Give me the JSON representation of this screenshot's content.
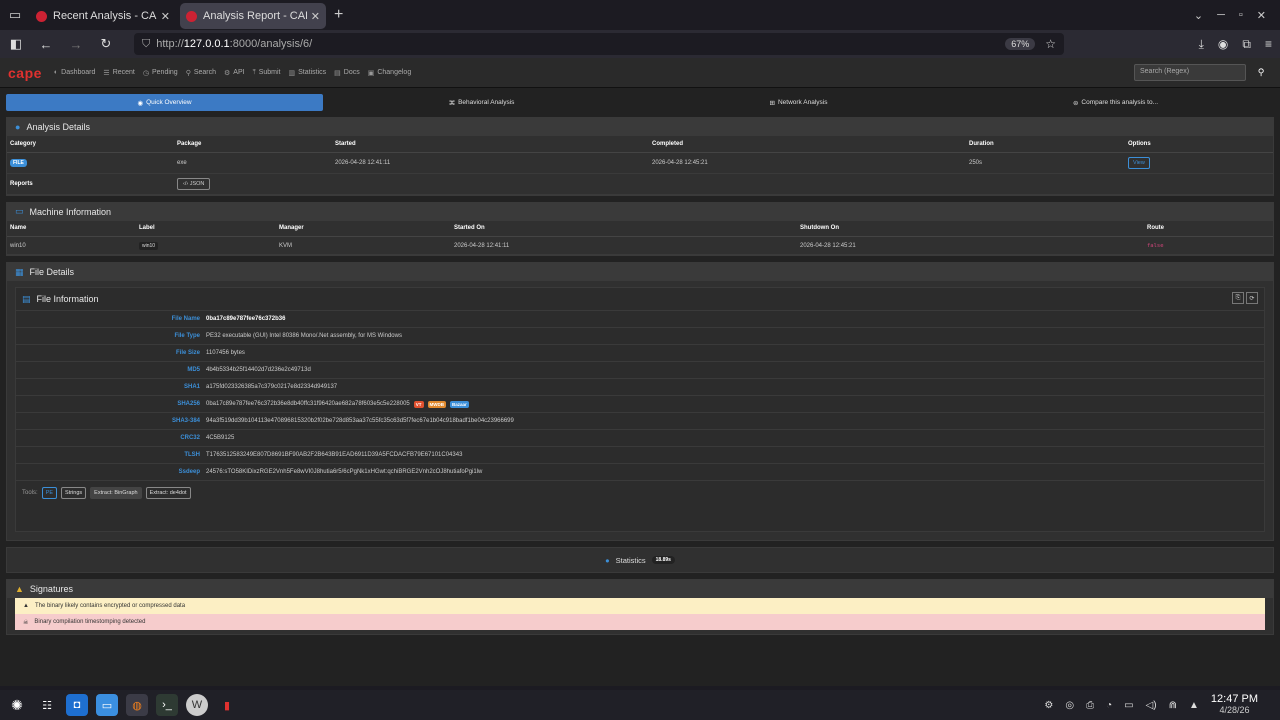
{
  "browser": {
    "tabs": [
      {
        "title": "Recent Analysis - CAPE Sandbox",
        "active": false
      },
      {
        "title": "Analysis Report - CAPE Sandbox",
        "active": true
      }
    ],
    "url_prefix": "http://",
    "url_host": "127.0.0.1",
    "url_path": ":8000/analysis/6/",
    "zoom": "67%"
  },
  "cape_nav": {
    "logo": "cape",
    "links": [
      "Dashboard",
      "Recent",
      "Pending",
      "Search",
      "API",
      "Submit",
      "Statistics",
      "Docs",
      "Changelog"
    ],
    "search_placeholder": "Search (Regex)"
  },
  "tabs": [
    "Quick Overview",
    "Behavioral Analysis",
    "Network Analysis",
    "Compare this analysis to..."
  ],
  "analysis_details": {
    "title": "Analysis Details",
    "headers": [
      "Category",
      "Package",
      "Started",
      "Completed",
      "Duration",
      "Options"
    ],
    "row": {
      "category": "FILE",
      "package": "exe",
      "started": "2026-04-28 12:41:11",
      "completed": "2026-04-28 12:45:21",
      "duration": "250s",
      "options": "View"
    },
    "reports_label": "Reports",
    "json_button": "JSON"
  },
  "machine_info": {
    "title": "Machine Information",
    "headers": [
      "Name",
      "Label",
      "Manager",
      "Started On",
      "Shutdown On",
      "Route"
    ],
    "row": {
      "name": "win10",
      "label": "win10",
      "manager": "KVM",
      "started_on": "2026-04-28 12:41:11",
      "shutdown_on": "2026-04-28 12:45:21",
      "route": "false"
    }
  },
  "file_details": {
    "title": "File Details",
    "sub_title": "File Information",
    "fields": [
      {
        "key": "File Name",
        "value": "0ba17c89e787fee76c372b36"
      },
      {
        "key": "File Type",
        "value": "PE32 executable (GUI) Intel 80386 Mono/.Net assembly, for MS Windows"
      },
      {
        "key": "File Size",
        "value": "1107456 bytes"
      },
      {
        "key": "MD5",
        "value": "4b4b5334b25f14402d7d236e2c49713d"
      },
      {
        "key": "SHA1",
        "value": "a175fd023326385a7c379c0217e8d2334d949137"
      },
      {
        "key": "SHA256",
        "value": "0ba17c89e787fee76c372b36e8db40ffc31f96420ae682a78f603e5c5e228005"
      },
      {
        "key": "SHA3-384",
        "value": "94a3f519dd39b104113e470896815320b2f02be728d853aa37c55fc35c63d5f7fec67e1b04c918badf1be04c23966699"
      },
      {
        "key": "CRC32",
        "value": "4C5B9125"
      },
      {
        "key": "TLSH",
        "value": "T1763512583249E807D8691BF90AB2F2B643B91EAD6911D39A5FCDACFB79E67101C04343"
      },
      {
        "key": "Ssdeep",
        "value": "24576:sTO58KIDixzRGE2Vnh5Fe8wVI0J8hutia6r5/6cPgNk1xHGwt:qchiBRGE2Vnh2cOJ8hutiafoPgi1lw"
      }
    ],
    "sha256_badges": [
      {
        "label": "VT",
        "color": "#e0512f"
      },
      {
        "label": "MWDB",
        "color": "#e08a2f"
      },
      {
        "label": "Bazaar",
        "color": "#3c8fd8"
      }
    ],
    "tools_label": "Tools:",
    "tools": [
      "PE",
      "Strings",
      "Extract: BinGraph",
      "Extract: de4dot"
    ]
  },
  "statistics": {
    "label": "Statistics",
    "value": "18.89s"
  },
  "signatures": {
    "title": "Signatures",
    "items": [
      {
        "text": "The binary likely contains encrypted or compressed data",
        "level": "warn"
      },
      {
        "text": "Binary compilation timestomping detected",
        "level": "danger"
      }
    ]
  },
  "taskbar": {
    "time": "12:47 PM",
    "date": "4/28/26"
  }
}
